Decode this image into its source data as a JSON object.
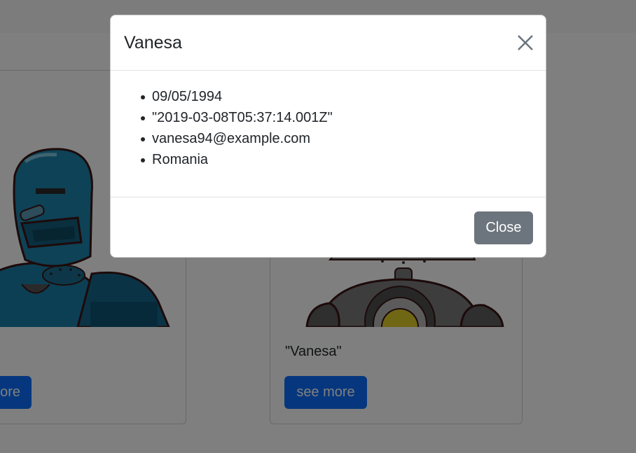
{
  "background": {
    "cards": [
      {
        "title": "",
        "button_label": "see more",
        "button_visible_label": "ore",
        "avatar": "blue-robot-avatar"
      },
      {
        "title": "\"Vanesa\"",
        "button_label": "see more",
        "avatar": "gray-robot-avatar"
      }
    ]
  },
  "modal": {
    "title": "Vanesa",
    "close_icon": "close-icon",
    "details": [
      "09/05/1994",
      "\"2019-03-08T05:37:14.001Z\"",
      "vanesa94@example.com",
      "Romania"
    ],
    "footer_close_label": "Close"
  },
  "colors": {
    "primary": "#0d6efd",
    "secondary": "#6c757d",
    "backdrop": "rgba(0,0,0,0.5)"
  }
}
